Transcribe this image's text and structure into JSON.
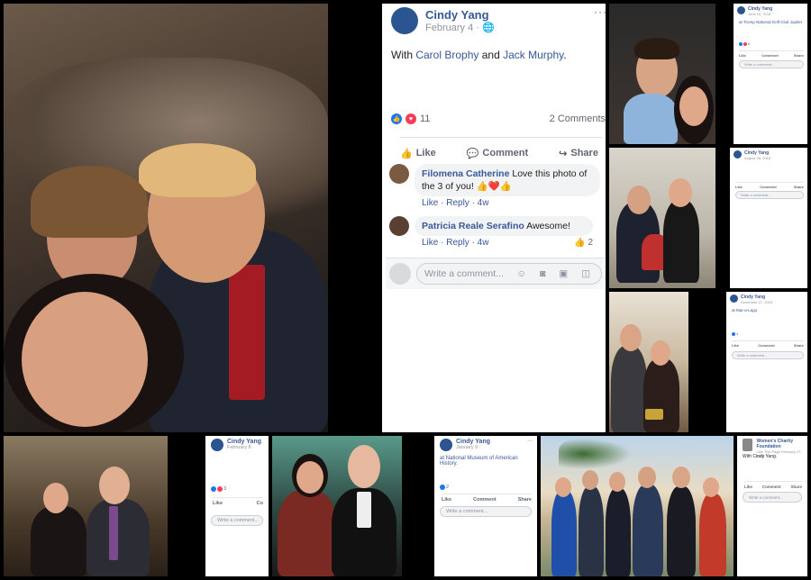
{
  "main_post": {
    "author": "Cindy Yang",
    "date": "February 4 · ",
    "with_text": "With",
    "tag1": "Carol Brophy",
    "and_text": "and",
    "tag2": "Jack Murphy",
    "period": ".",
    "reaction_count": "11",
    "comment_count": "2 Comments",
    "actions": [
      "Like",
      "Comment",
      "Share"
    ],
    "comments": [
      {
        "author": "Filomena Catherine",
        "text": "Love this photo of the 3 of you! 👍❤️👍",
        "meta": "Like · Reply · 4w"
      },
      {
        "author": "Patricia Reale Serafino",
        "text": "Awesome!",
        "meta": "Like · Reply · 4w",
        "likes": "2"
      }
    ],
    "write_placeholder": "Write a comment..."
  },
  "card_trump_club": {
    "author": "Cindy Yang",
    "date": "June 16, 2018 ·",
    "location": "at Trump National Golf Club Jupiter",
    "count": "6",
    "actions": [
      "Like",
      "Comment",
      "Share"
    ],
    "write_placeholder": "Write a comment..."
  },
  "card_aug": {
    "author": "Cindy Yang",
    "date": "August 28, 2018 ·",
    "actions": [
      "Like",
      "Comment",
      "Share"
    ],
    "write_placeholder": "Write a comment..."
  },
  "card_mar_a_lago": {
    "author": "Cindy Yang",
    "date": "December 27, 2018 ·",
    "location": "at Mar-a-Lago.",
    "count": "3",
    "actions": [
      "Like",
      "Comment",
      "Share"
    ],
    "write_placeholder": "Write a comment..."
  },
  "card_feb8": {
    "author": "Cindy Yang",
    "date": "February 8 ·",
    "count": "3",
    "actions": [
      "Like",
      "Co"
    ],
    "write_placeholder": "Write a comment..."
  },
  "card_museum": {
    "author": "Cindy Yang",
    "date": "January 9 ·",
    "location": "at National Museum of American History.",
    "count": "2",
    "actions": [
      "Like",
      "Comment",
      "Share"
    ],
    "write_placeholder": "Write a comment..."
  },
  "card_charity": {
    "author": "Women's Charity Foundation",
    "like_page": "Like This Page",
    "date": "February 27, 2019 ·",
    "with_text": "With Cindy Yang.",
    "actions": [
      "Like",
      "Comment",
      "Share"
    ],
    "write_placeholder": "Write a comment..."
  },
  "colors": {
    "fb_blue": "#385898",
    "like_blue": "#1877f2",
    "heart_red": "#f33e58",
    "background": "#000000"
  }
}
